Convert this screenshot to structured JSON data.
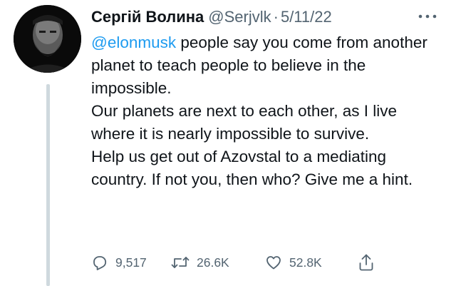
{
  "author": {
    "display_name": "Сергій Волина",
    "handle": "@Serjvlk",
    "separator": "·",
    "date": "5/11/22",
    "avatar_icon": "profile-photo"
  },
  "tweet": {
    "mention": "@elonmusk",
    "paragraphs": [
      " people say you come from another planet to teach people to believe in the impossible.",
      "Our planets are next to each other, as I live where it is nearly impossible to survive.",
      "Help us get out of Azovstal to a mediating country. If not you, then who? Give me a hint."
    ]
  },
  "actions": {
    "replies": "9,517",
    "retweets": "26.6K",
    "likes": "52.8K",
    "icons": [
      "reply-icon",
      "retweet-icon",
      "like-icon",
      "share-icon"
    ]
  },
  "colors": {
    "text": "#0f1419",
    "secondary": "#536471",
    "link": "#1d9bf0",
    "thread_line": "#cfd9de"
  }
}
